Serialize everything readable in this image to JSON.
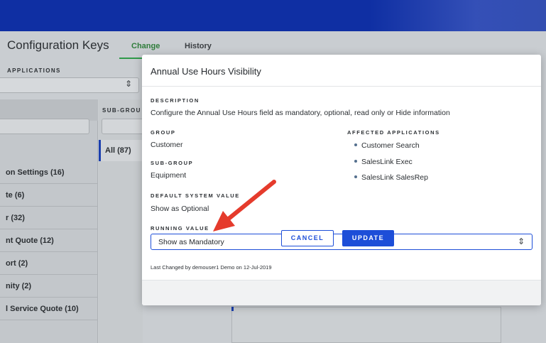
{
  "background": {
    "page_title": "Configuration Keys",
    "tabs": [
      {
        "label": "Change",
        "active": true
      },
      {
        "label": "History",
        "active": false
      }
    ],
    "applications_label": "APPLICATIONS",
    "subgroup_label": "SUB-GROU",
    "subgroup_all": "All (87)",
    "groups": [
      "on Settings (16)",
      "te (6)",
      "r (32)",
      "nt Quote (12)",
      "ort (2)",
      "nity (2)",
      "l Service Quote (10)"
    ]
  },
  "modal": {
    "title": "Annual Use Hours Visibility",
    "description_label": "DESCRIPTION",
    "description": "Configure the Annual Use Hours field as mandatory, optional, read only or Hide information",
    "group_label": "GROUP",
    "group": "Customer",
    "subgroup_label": "SUB-GROUP",
    "subgroup": "Equipment",
    "affected_label": "AFFECTED APPLICATIONS",
    "affected_applications": [
      "Customer Search",
      "SalesLink Exec",
      "SalesLink SalesRep"
    ],
    "default_label": "DEFAULT SYSTEM VALUE",
    "default_value": "Show as Optional",
    "running_label": "RUNNING VALUE",
    "running_value": "Show as Mandatory",
    "last_changed": "Last Changed by demouser1 Demo on 12-Jul-2019",
    "cancel_label": "CANCEL",
    "update_label": "UPDATE"
  },
  "colors": {
    "topbar": "#0f2fa3",
    "accent": "#1d4ed8",
    "active_tab": "#2f7d3b",
    "annotation_arrow": "#e53b2c"
  },
  "icons": {
    "select_arrow": "up-down-chevron-icon",
    "annotation": "red-arrow-icon"
  }
}
